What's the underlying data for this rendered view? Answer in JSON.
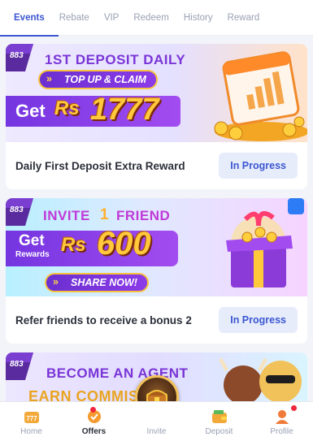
{
  "tabs": [
    {
      "label": "Events"
    },
    {
      "label": "Rebate"
    },
    {
      "label": "VIP"
    },
    {
      "label": "Redeem"
    },
    {
      "label": "History"
    },
    {
      "label": "Reward"
    }
  ],
  "cards": [
    {
      "badge": "883",
      "headline": "1ST DEPOSIT DAILY",
      "pill": "TOP UP & CLAIM",
      "prefix": "Get",
      "currency": "Rs",
      "amount": "1777",
      "title": "Daily First Deposit Extra Reward",
      "status": "In Progress"
    },
    {
      "badge": "883",
      "headline_pre": "INVITE",
      "headline_num": "1",
      "headline_post": "FRIEND",
      "prefix": "Get",
      "prefix2": "Rewards",
      "currency": "Rs",
      "amount": "600",
      "pill": "SHARE NOW!",
      "title": "Refer friends to receive a bonus 2",
      "status": "In Progress"
    },
    {
      "badge": "883",
      "headline": "BECOME AN AGENT",
      "subline": "EARN COMMISSION"
    }
  ],
  "bottom_nav": [
    {
      "label": "Home",
      "icon": "home-icon"
    },
    {
      "label": "Offers",
      "icon": "offers-icon"
    },
    {
      "label": "Invite",
      "icon": "invite-icon"
    },
    {
      "label": "Deposit",
      "icon": "wallet-icon"
    },
    {
      "label": "Profile",
      "icon": "profile-icon"
    }
  ],
  "colors": {
    "accent": "#3b57d1",
    "status_bg": "#e7ecfb",
    "badge_red": "#f0263c"
  }
}
